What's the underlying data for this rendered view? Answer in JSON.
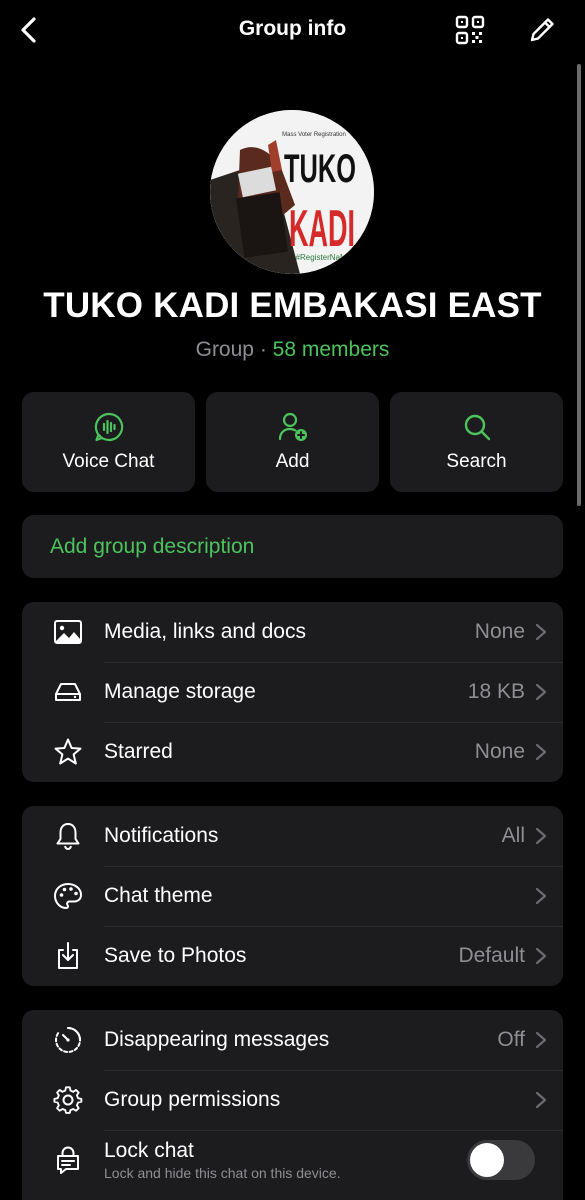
{
  "header": {
    "title": "Group info",
    "back_icon": "chevron-left-icon",
    "qr_icon": "qr-code-icon",
    "edit_icon": "pencil-icon"
  },
  "group": {
    "avatar_lines": [
      "Mass Voter Registration",
      "TUKO",
      "KADI",
      "#RegisterNaMl"
    ],
    "name": "TUKO KADI EMBAKASI EAST",
    "type": "Group",
    "separator": " · ",
    "members": "58 members"
  },
  "actions": [
    {
      "label": "Voice Chat",
      "icon": "voice-chat-icon"
    },
    {
      "label": "Add",
      "icon": "add-person-icon"
    },
    {
      "label": "Search",
      "icon": "search-icon"
    }
  ],
  "description": {
    "label": "Add group description"
  },
  "section1": [
    {
      "label": "Media, links and docs",
      "value": "None",
      "icon": "image-icon"
    },
    {
      "label": "Manage storage",
      "value": "18 KB",
      "icon": "storage-icon"
    },
    {
      "label": "Starred",
      "value": "None",
      "icon": "star-icon"
    }
  ],
  "section2": [
    {
      "label": "Notifications",
      "value": "All",
      "icon": "bell-icon"
    },
    {
      "label": "Chat theme",
      "value": "",
      "icon": "palette-icon"
    },
    {
      "label": "Save to Photos",
      "value": "Default",
      "icon": "download-icon"
    }
  ],
  "section3": [
    {
      "label": "Disappearing messages",
      "value": "Off",
      "icon": "timer-icon"
    },
    {
      "label": "Group permissions",
      "value": "",
      "icon": "settings-icon"
    }
  ],
  "lock_chat": {
    "label": "Lock chat",
    "sublabel": "Lock and hide this chat on this device.",
    "toggle_on": false,
    "icon": "lock-chat-icon"
  },
  "colors": {
    "accent": "#4cc35c",
    "background": "#000000",
    "card": "#1c1c1e",
    "secondary_text": "#8e8e93"
  }
}
